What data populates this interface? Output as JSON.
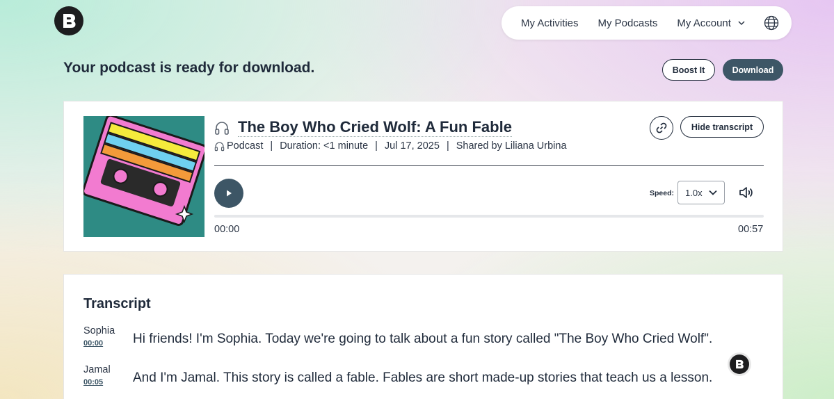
{
  "nav": {
    "activities": "My Activities",
    "podcasts": "My Podcasts",
    "account": "My Account"
  },
  "headline": "Your podcast is ready for download.",
  "actions": {
    "boost": "Boost It",
    "download": "Download"
  },
  "podcast": {
    "title": "The Boy Who Cried Wolf: A Fun Fable",
    "type": "Podcast",
    "duration": "Duration: <1 minute",
    "date": "Jul 17, 2025",
    "shared_by": "Shared by Liliana Urbina",
    "separator": "|",
    "hide_transcript": "Hide transcript"
  },
  "player": {
    "speed_label": "Speed:",
    "speed_value": "1.0x",
    "current_time": "00:00",
    "total_time": "00:57",
    "progress": 0
  },
  "transcript": {
    "heading": "Transcript",
    "lines": [
      {
        "speaker": "Sophia",
        "time": "00:00",
        "text": "Hi friends! I'm Sophia. Today we're going to talk about a fun story called \"The Boy Who Cried Wolf\"."
      },
      {
        "speaker": "Jamal",
        "time": "00:05",
        "text": "And I'm Jamal. This story is called a fable. Fables are short made-up stories that teach us a lesson."
      }
    ]
  },
  "colors": {
    "accent": "#3d5666",
    "text": "#1f2a3a"
  },
  "icons": {
    "logo": "logo-icon",
    "globe": "globe-icon",
    "headphones": "headphones-icon",
    "link": "link-icon",
    "play": "play-icon",
    "volume": "volume-icon",
    "chevron": "chevron-down-icon"
  }
}
